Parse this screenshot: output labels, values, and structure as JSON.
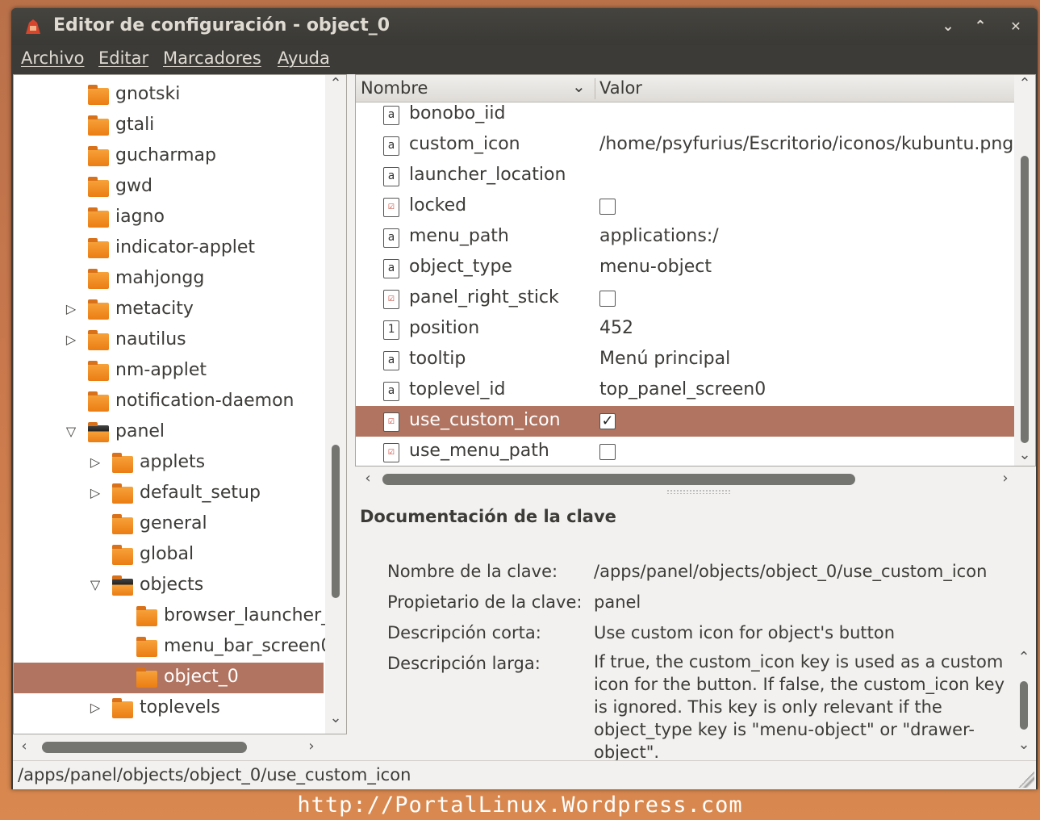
{
  "window": {
    "title": "Editor de configuración - object_0",
    "controls": {
      "minimize": "⌄",
      "maximize": "⌃",
      "close": "✕"
    }
  },
  "menubar": [
    "Archivo",
    "Editar",
    "Marcadores",
    "Ayuda"
  ],
  "tree": {
    "items": [
      {
        "label": "gnotski",
        "indent": 0,
        "expander": "",
        "selected": false
      },
      {
        "label": "gtali",
        "indent": 0,
        "expander": "",
        "selected": false
      },
      {
        "label": "gucharmap",
        "indent": 0,
        "expander": "",
        "selected": false
      },
      {
        "label": "gwd",
        "indent": 0,
        "expander": "",
        "selected": false
      },
      {
        "label": "iagno",
        "indent": 0,
        "expander": "",
        "selected": false
      },
      {
        "label": "indicator-applet",
        "indent": 0,
        "expander": "",
        "selected": false
      },
      {
        "label": "mahjongg",
        "indent": 0,
        "expander": "",
        "selected": false
      },
      {
        "label": "metacity",
        "indent": 0,
        "expander": "collapsed",
        "selected": false
      },
      {
        "label": "nautilus",
        "indent": 0,
        "expander": "collapsed",
        "selected": false
      },
      {
        "label": "nm-applet",
        "indent": 0,
        "expander": "",
        "selected": false
      },
      {
        "label": "notification-daemon",
        "indent": 0,
        "expander": "",
        "selected": false
      },
      {
        "label": "panel",
        "indent": 0,
        "expander": "expanded",
        "selected": false
      },
      {
        "label": "applets",
        "indent": 1,
        "expander": "collapsed",
        "selected": false
      },
      {
        "label": "default_setup",
        "indent": 1,
        "expander": "collapsed",
        "selected": false
      },
      {
        "label": "general",
        "indent": 1,
        "expander": "",
        "selected": false
      },
      {
        "label": "global",
        "indent": 1,
        "expander": "",
        "selected": false
      },
      {
        "label": "objects",
        "indent": 1,
        "expander": "expanded",
        "selected": false
      },
      {
        "label": "browser_launcher_",
        "indent": 2,
        "expander": "",
        "selected": false
      },
      {
        "label": "menu_bar_screen0",
        "indent": 2,
        "expander": "",
        "selected": false
      },
      {
        "label": "object_0",
        "indent": 2,
        "expander": "",
        "selected": true
      },
      {
        "label": "toplevels",
        "indent": 1,
        "expander": "collapsed",
        "selected": false
      }
    ]
  },
  "list": {
    "columns": {
      "name": "Nombre",
      "value": "Valor"
    },
    "rows": [
      {
        "name": "bonobo_iid",
        "type": "string",
        "value": "",
        "checked": null,
        "selected": false
      },
      {
        "name": "custom_icon",
        "type": "string",
        "value": "/home/psyfurius/Escritorio/iconos/kubuntu.png",
        "checked": null,
        "selected": false
      },
      {
        "name": "launcher_location",
        "type": "string",
        "value": "",
        "checked": null,
        "selected": false
      },
      {
        "name": "locked",
        "type": "bool",
        "value": "",
        "checked": false,
        "selected": false
      },
      {
        "name": "menu_path",
        "type": "string",
        "value": "applications:/",
        "checked": null,
        "selected": false
      },
      {
        "name": "object_type",
        "type": "string",
        "value": "menu-object",
        "checked": null,
        "selected": false
      },
      {
        "name": "panel_right_stick",
        "type": "bool",
        "value": "",
        "checked": false,
        "selected": false
      },
      {
        "name": "position",
        "type": "int",
        "value": "452",
        "checked": null,
        "selected": false
      },
      {
        "name": "tooltip",
        "type": "string",
        "value": "Menú principal",
        "checked": null,
        "selected": false
      },
      {
        "name": "toplevel_id",
        "type": "string",
        "value": "top_panel_screen0",
        "checked": null,
        "selected": false
      },
      {
        "name": "use_custom_icon",
        "type": "bool",
        "value": "",
        "checked": true,
        "selected": true
      },
      {
        "name": "use_menu_path",
        "type": "bool",
        "value": "",
        "checked": false,
        "selected": false
      }
    ]
  },
  "documentation": {
    "title": "Documentación de la clave",
    "key_name_label": "Nombre de la clave:",
    "key_name": "/apps/panel/objects/object_0/use_custom_icon",
    "owner_label": "Propietario de la clave:",
    "owner": "panel",
    "short_label": "Descripción corta:",
    "short": "Use custom icon for object's button",
    "long_label": "Descripción larga:",
    "long": "If true, the custom_icon key is used as a custom icon for the button. If false, the custom_icon key is ignored. This key is only relevant if the object_type key is \"menu-object\" or \"drawer-object\"."
  },
  "statusbar": {
    "path": "/apps/panel/objects/object_0/use_custom_icon"
  },
  "watermark": "http://PortalLinux.Wordpress.com",
  "colors": {
    "selection": "#b07461",
    "folder": "#ea7d13",
    "titlebar": "#3c3b37"
  }
}
